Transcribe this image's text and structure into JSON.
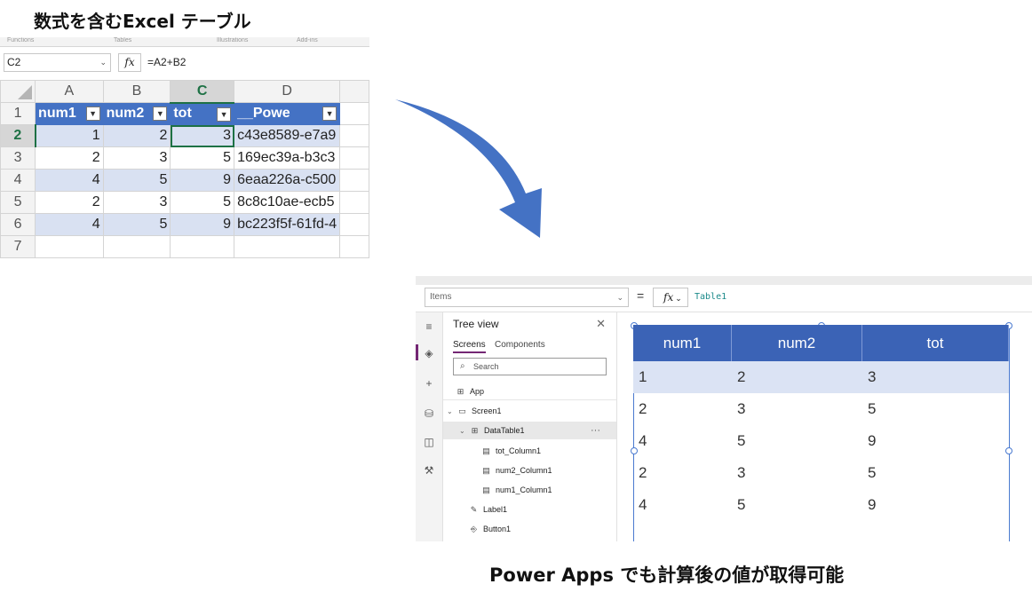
{
  "captions": {
    "excel": "数式を含むExcel テーブル",
    "power_apps": "Power Apps でも計算後の値が取得可能"
  },
  "excel": {
    "ribbon_groups": [
      "Functions",
      "Tables",
      "Illustrations",
      "Add-ins"
    ],
    "name_box": "C2",
    "fx_label": "fx",
    "formula": "=A2+B2",
    "column_headers": [
      "A",
      "B",
      "C",
      "D"
    ],
    "selected_column": "C",
    "row_numbers": [
      "1",
      "2",
      "3",
      "4",
      "5",
      "6",
      "7"
    ],
    "selected_row": "2",
    "table_headers": [
      "num1",
      "num2",
      "tot",
      "__Powe"
    ],
    "rows": [
      [
        "1",
        "2",
        "3",
        "c43e8589-e7a9"
      ],
      [
        "2",
        "3",
        "5",
        "169ec39a-b3c3"
      ],
      [
        "4",
        "5",
        "9",
        "6eaa226a-c500"
      ],
      [
        "2",
        "3",
        "5",
        "8c8c10ae-ecb5"
      ],
      [
        "4",
        "5",
        "9",
        "bc223f5f-61fd-4"
      ]
    ],
    "header_color": "#4472c4",
    "band_color": "#d9e1f2",
    "accent_green": "#1e7145"
  },
  "power_apps": {
    "property": "Items",
    "equals": "=",
    "fx_label": "fx",
    "formula": "Table1",
    "tree_view": {
      "title": "Tree view",
      "tabs": [
        "Screens",
        "Components"
      ],
      "search_placeholder": "Search",
      "nodes": {
        "app": "App",
        "screen": "Screen1",
        "datatable": "DataTable1",
        "more": "···",
        "col_tot": "tot_Column1",
        "col_num2": "num2_Column1",
        "col_num1": "num1_Column1",
        "label": "Label1",
        "button": "Button1"
      }
    },
    "rail_icons": [
      "hamburger-icon",
      "layers-icon",
      "plus-icon",
      "database-icon",
      "media-icon",
      "tools-icon"
    ],
    "data_table": {
      "headers": [
        "num1",
        "num2",
        "tot"
      ],
      "rows": [
        [
          "1",
          "2",
          "3"
        ],
        [
          "2",
          "3",
          "5"
        ],
        [
          "4",
          "5",
          "9"
        ],
        [
          "2",
          "3",
          "5"
        ],
        [
          "4",
          "5",
          "9"
        ]
      ],
      "header_color": "#3b63b6",
      "selected_row_color": "#dbe3f4"
    },
    "accent_purple": "#742774"
  }
}
